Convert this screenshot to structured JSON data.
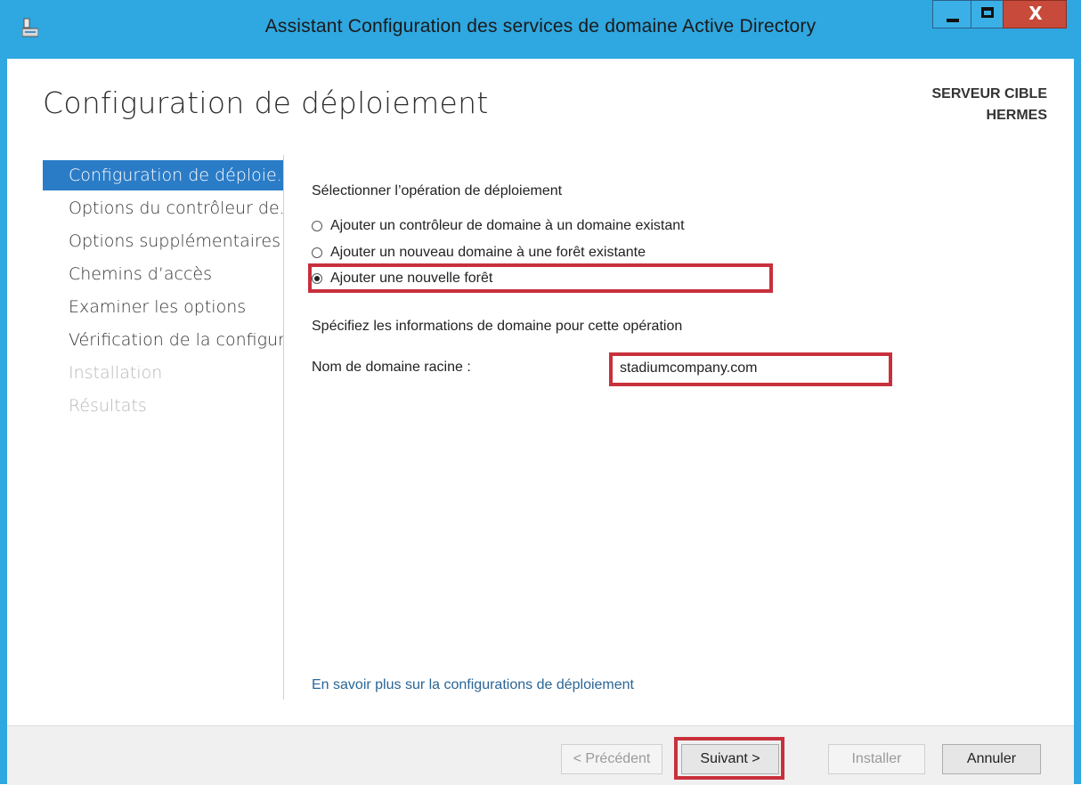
{
  "window": {
    "title": "Assistant Configuration des services de domaine Active Directory",
    "close_label": "X",
    "accent_color": "#2fa7e0",
    "highlight_color": "#c8303c"
  },
  "header": {
    "page_title": "Configuration de déploiement",
    "target_label": "SERVEUR CIBLE",
    "target_server": "HERMES"
  },
  "nav": {
    "items": [
      {
        "label": "Configuration de déploie...",
        "state": "active"
      },
      {
        "label": "Options du contrôleur de...",
        "state": "enabled"
      },
      {
        "label": "Options supplémentaires",
        "state": "enabled"
      },
      {
        "label": "Chemins d’accès",
        "state": "enabled"
      },
      {
        "label": "Examiner les options",
        "state": "enabled"
      },
      {
        "label": "Vérification de la configur...",
        "state": "enabled"
      },
      {
        "label": "Installation",
        "state": "disabled"
      },
      {
        "label": "Résultats",
        "state": "disabled"
      }
    ]
  },
  "main": {
    "operation_label": "Sélectionner l’opération de déploiement",
    "options": [
      {
        "label": "Ajouter un contrôleur de domaine à un domaine existant",
        "selected": false
      },
      {
        "label": "Ajouter un nouveau domaine à une forêt existante",
        "selected": false
      },
      {
        "label": "Ajouter une nouvelle forêt",
        "selected": true
      }
    ],
    "domain_info_label": "Spécifiez les informations de domaine pour cette opération",
    "root_domain_label": "Nom de domaine racine :",
    "root_domain_value": "stadiumcompany.com",
    "learn_more_link": "En savoir plus sur la configurations de déploiement"
  },
  "footer": {
    "prev_label": "< Précédent",
    "next_label": "Suivant >",
    "install_label": "Installer",
    "cancel_label": "Annuler"
  }
}
